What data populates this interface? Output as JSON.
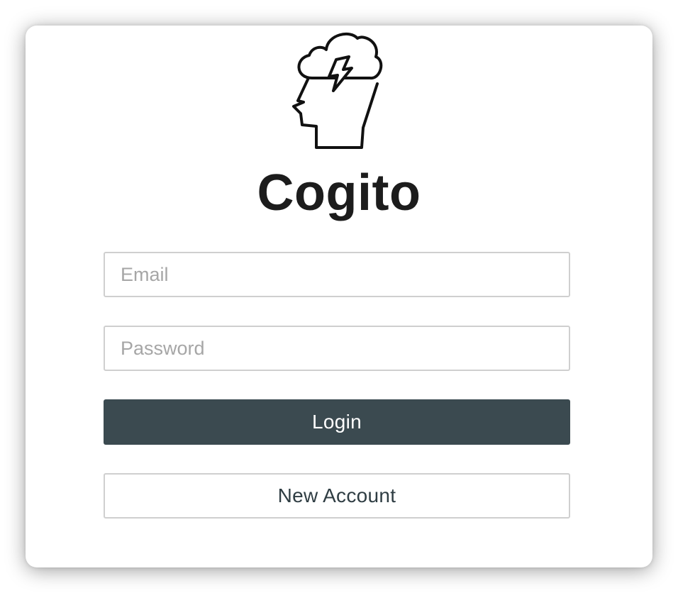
{
  "app": {
    "title": "Cogito",
    "logo_icon": "head-with-storm-cloud-icon"
  },
  "form": {
    "email_placeholder": "Email",
    "email_value": "",
    "password_placeholder": "Password",
    "password_value": "",
    "login_label": "Login",
    "new_account_label": "New Account"
  },
  "colors": {
    "primary_button": "#3b4a50",
    "title_text": "#1c1c1c",
    "border": "#cfcfcf"
  }
}
